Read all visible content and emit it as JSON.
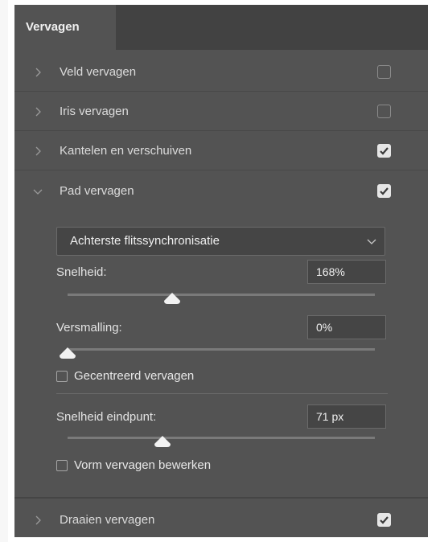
{
  "panel": {
    "tab_label": "Vervagen"
  },
  "sections": [
    {
      "label": "Veld vervagen",
      "expanded": false,
      "checked": false
    },
    {
      "label": "Iris vervagen",
      "expanded": false,
      "checked": false
    },
    {
      "label": "Kantelen en verschuiven",
      "expanded": false,
      "checked": true
    },
    {
      "label": "Pad vervagen",
      "expanded": true,
      "checked": true
    },
    {
      "label": "Draaien vervagen",
      "expanded": false,
      "checked": true
    }
  ],
  "path_blur": {
    "mode_dropdown": {
      "selected": "Achterste flitssynchronisatie"
    },
    "speed": {
      "label": "Snelheid:",
      "value": "168%",
      "slider_fraction": 0.34
    },
    "taper": {
      "label": "Versmalling:",
      "value": "0%",
      "slider_fraction": 0.0
    },
    "centered_blur": {
      "label": "Gecentreerd vervagen",
      "checked": false
    },
    "endpoint_speed": {
      "label": "Snelheid eindpunt:",
      "value": "71 px",
      "slider_fraction": 0.31
    },
    "edit_blur_shape": {
      "label": "Vorm vervagen bewerken",
      "checked": false
    }
  },
  "colors": {
    "panel_bg": "#535353",
    "tab_bar_bg": "#424242",
    "checked_box": "#e6e6e6"
  }
}
